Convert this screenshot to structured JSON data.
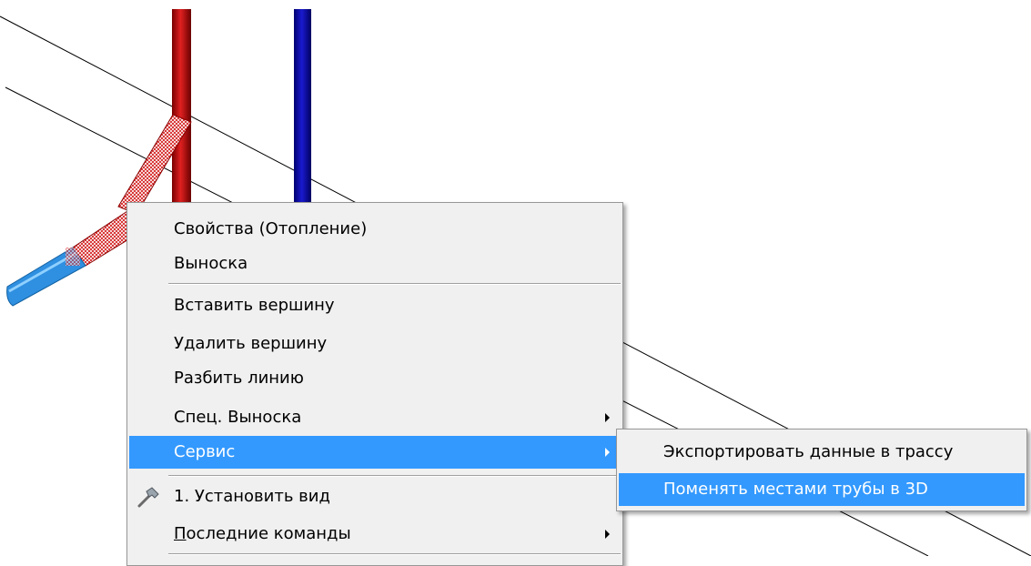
{
  "context_menu": {
    "items": [
      {
        "label": "Свойства (Отопление)"
      },
      {
        "label": "Выноска"
      },
      {
        "label": "Вставить вершину"
      },
      {
        "label": "Удалить вершину"
      },
      {
        "label": "Разбить линию"
      },
      {
        "label": "Спец. Выноска"
      },
      {
        "label": "Сервис"
      },
      {
        "label": "1. Установить вид",
        "icon": "hammer-icon"
      },
      {
        "label_accel": "П",
        "label_rest": "оследние команды"
      }
    ]
  },
  "submenu": {
    "items": [
      {
        "label": "Экспортировать данные в трассу"
      },
      {
        "label": "Поменять местами трубы в 3D"
      }
    ]
  },
  "colors": {
    "highlight": "#3399ff",
    "supply_pipe": "#c00000",
    "return_pipe": "#0000b0",
    "light_pipe": "#2f8fe0",
    "menu_bg": "#f0f0f0"
  }
}
